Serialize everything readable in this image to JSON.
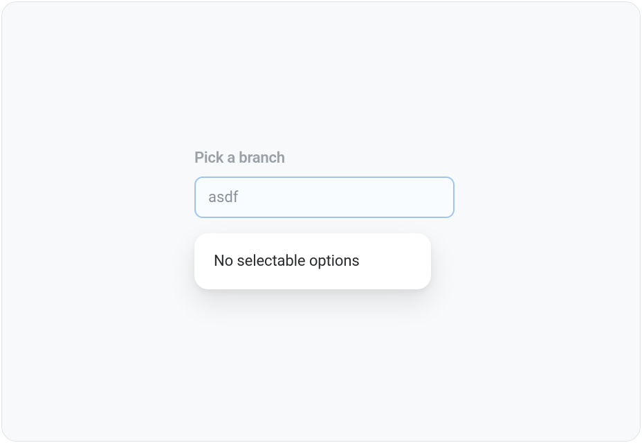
{
  "form": {
    "label": "Pick a branch",
    "input_value": "asdf"
  },
  "dropdown": {
    "empty_message": "No selectable options"
  }
}
